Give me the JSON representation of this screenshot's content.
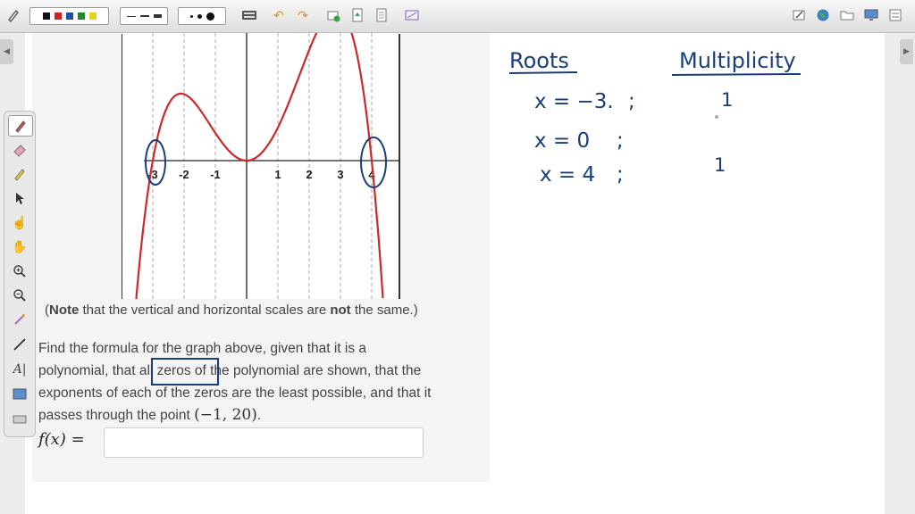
{
  "toolbar": {
    "colors": [
      "#111111",
      "#d42020",
      "#1f4fa8",
      "#1f8a2c",
      "#e6d21f"
    ],
    "line_styles": [
      "thin-dash",
      "medium-dash",
      "thick-dash"
    ],
    "point_sizes": [
      "small",
      "medium",
      "large"
    ],
    "icons_left": [
      "pen-icon",
      "keyboard-icon",
      "undo-icon",
      "redo-icon",
      "add-page-icon",
      "insert-page-icon",
      "document-icon",
      "screen-capture-icon"
    ],
    "icons_right": [
      "edit-icon",
      "globe-icon",
      "folder-icon",
      "desktop-icon",
      "settings-icon"
    ]
  },
  "side_toolbar": {
    "tools": [
      "pen-icon",
      "eraser-icon",
      "highlighter-icon",
      "select-arrow-icon",
      "pointer-hand-icon",
      "pan-hand-icon",
      "zoom-in-icon",
      "zoom-out-icon",
      "magic-pen-icon",
      "line-icon",
      "text-icon",
      "screen-icon",
      "keyboard-icon"
    ]
  },
  "graph": {
    "x_tick_labels": [
      "-3",
      "-2",
      "-1",
      "1",
      "2",
      "3",
      "4"
    ],
    "curve_color": "#c92a2a",
    "grid_color": "#aaaaaa"
  },
  "problem": {
    "note_bold_1": "Note",
    "note_part_1": " that the vertical and horizontal scales are ",
    "note_bold_2": "not",
    "note_part_2": " the same.)",
    "note_open": "(",
    "text_line_1": "Find the formula for the graph above, given that it is a",
    "text_line_2": "polynomial, that all zeros of the polynomial are shown, that the",
    "text_line_3": "exponents of each of the zeros are the least possible, and that it",
    "text_line_4": "passes through the point ",
    "point": "(−1, 20)",
    "period": ".",
    "fx_label": "f(x) ="
  },
  "answer": {
    "value": ""
  },
  "notes": {
    "roots_heading": "Roots",
    "multiplicity_heading": "Multiplicity",
    "rows": [
      {
        "root": "x = −3.",
        "sep": ";",
        "mult": "1"
      },
      {
        "root": "x = 0",
        "sep": ";",
        "mult": ""
      },
      {
        "root": "x = 4",
        "sep": ";",
        "mult": "1"
      }
    ]
  }
}
